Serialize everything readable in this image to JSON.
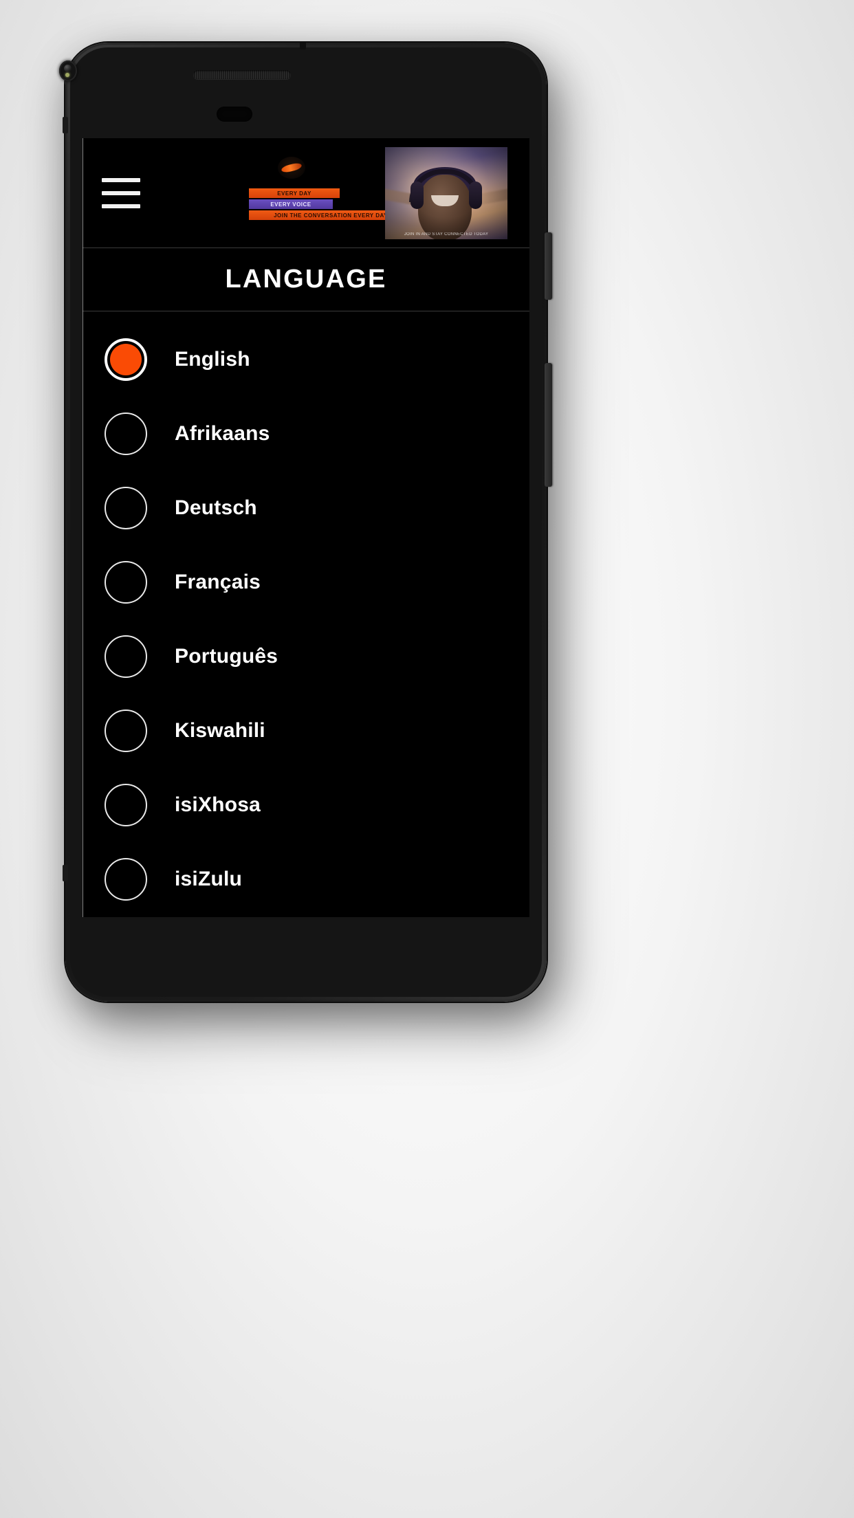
{
  "device": {
    "frame_color": "#1a1a1a",
    "background_color": "#ececec",
    "camera_icon": "front-camera-icon",
    "speaker_icon": "earpiece-speaker-icon"
  },
  "header": {
    "menu_icon": "hamburger-menu-icon",
    "brand": {
      "emblem_icon": "brand-emblem-icon",
      "bar_line_1": "EVERY DAY",
      "bar_line_2": "EVERY VOICE",
      "bar_line_3": "JOIN THE CONVERSATION EVERY DAY",
      "photo_alt": "smiling-child-wearing-headphones",
      "photo_caption": "JOIN IN AND STAY CONNECTED TODAY",
      "accent_orange": "#ef5a14",
      "accent_purple": "#5a41a8"
    }
  },
  "main": {
    "page_title": "LANGUAGE",
    "selected_language": "English",
    "selected_color": "#fa4b05",
    "languages": [
      {
        "label": "English",
        "selected": true
      },
      {
        "label": "Afrikaans",
        "selected": false
      },
      {
        "label": "Deutsch",
        "selected": false
      },
      {
        "label": "Français",
        "selected": false
      },
      {
        "label": "Português",
        "selected": false
      },
      {
        "label": "Kiswahili",
        "selected": false
      },
      {
        "label": "isiXhosa",
        "selected": false
      },
      {
        "label": "isiZulu",
        "selected": false
      }
    ]
  }
}
